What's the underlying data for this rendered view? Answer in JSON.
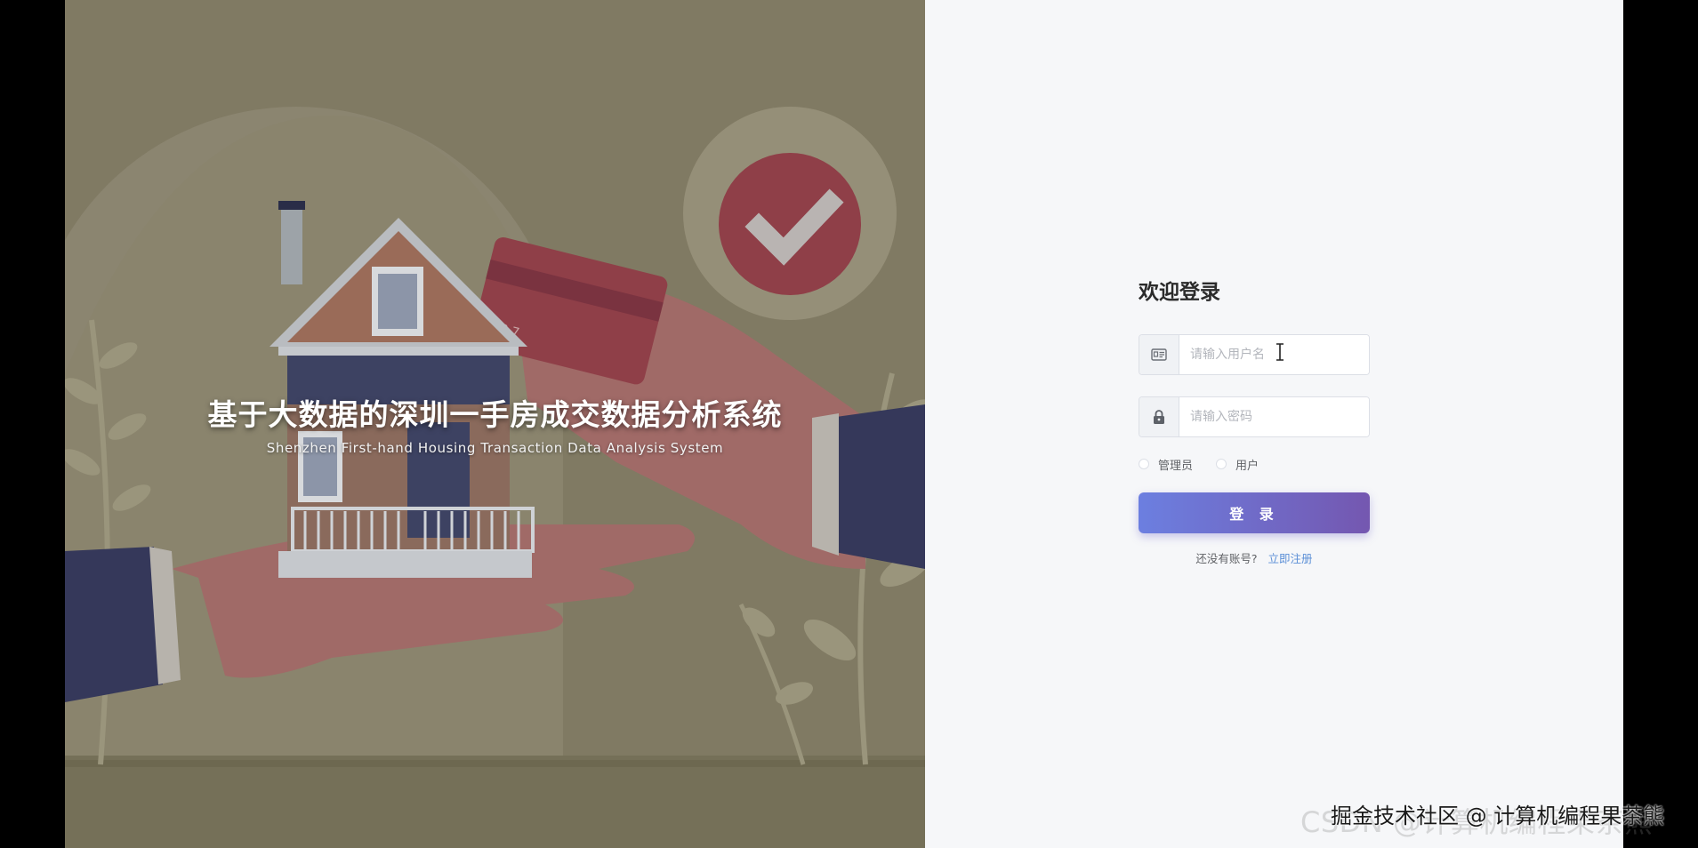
{
  "hero": {
    "title": "基于大数据的深圳一手房成交数据分析系统",
    "subtitle": "Shenzhen First-hand Housing Transaction Data Analysis System"
  },
  "login": {
    "title": "欢迎登录",
    "username_placeholder": "请输入用户名",
    "password_placeholder": "请输入密码",
    "username_icon": "id-card-icon",
    "password_icon": "lock-icon",
    "roles": [
      "管理员",
      "用户"
    ],
    "submit_label": "登 录",
    "register_prompt": "还没有账号?",
    "register_link": "立即注册",
    "accent_gradient": [
      "#6c7fe0",
      "#7457b0"
    ],
    "link_color": "#5b8fd6"
  },
  "watermark": {
    "back": "CSDN @计算机编程果茶熊",
    "front": "掘金技术社区 @ 计算机编程果茶熊"
  }
}
